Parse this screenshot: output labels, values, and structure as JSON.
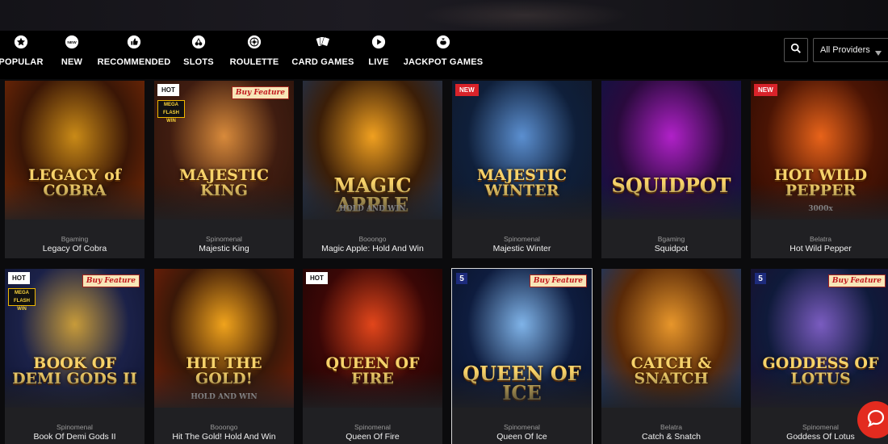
{
  "nav": {
    "items": [
      {
        "label": "POPULAR",
        "icon": "star-icon"
      },
      {
        "label": "NEW",
        "icon": "new-icon",
        "icon_text": "NEW"
      },
      {
        "label": "RECOMMENDED",
        "icon": "thumbs-up-icon"
      },
      {
        "label": "SLOTS",
        "icon": "cherries-icon"
      },
      {
        "label": "ROULETTE",
        "icon": "roulette-icon"
      },
      {
        "label": "CARD GAMES",
        "icon": "cards-icon"
      },
      {
        "label": "LIVE",
        "icon": "play-icon"
      },
      {
        "label": "JACKPOT GAMES",
        "icon": "money-bag-icon"
      }
    ],
    "provider_select": "All Providers"
  },
  "games": [
    {
      "provider": "Bgaming",
      "name": "Legacy Of Cobra",
      "art_title": "LEGACY of COBRA",
      "badge": "",
      "buy_feature": "",
      "colors": [
        "#3a1606",
        "#c98a17",
        "#7a2a05"
      ]
    },
    {
      "provider": "Spinomenal",
      "name": "Majestic King",
      "art_title": "MAJESTIC KING",
      "badge": "HOT",
      "buy_feature": "Buy Feature",
      "mega": "MEGA FLASH WIN",
      "colors": [
        "#3f1c10",
        "#d88a3b",
        "#2a130b"
      ]
    },
    {
      "provider": "Booongo",
      "name": "Magic Apple: Hold And Win",
      "art_title": "MAGIC APPLE",
      "art_subtitle": "HOLD AND WIN",
      "badge": "",
      "buy_feature": "",
      "colors": [
        "#3b1e08",
        "#f0a020",
        "#1c3558"
      ]
    },
    {
      "provider": "Spinomenal",
      "name": "Majestic Winter",
      "art_title": "MAJESTIC WINTER",
      "badge": "NEW",
      "buy_feature": "",
      "colors": [
        "#0f1f3a",
        "#5b8fd0",
        "#101829"
      ]
    },
    {
      "provider": "Bgaming",
      "name": "Squidpot",
      "art_title": "SQUIDPOT",
      "badge": "",
      "buy_feature": "",
      "colors": [
        "#2a0a3d",
        "#b021c8",
        "#0c1444"
      ]
    },
    {
      "provider": "Belatra",
      "name": "Hot Wild Pepper",
      "art_title": "HOT WILD PEPPER",
      "art_subtitle": "3000x",
      "badge": "NEW",
      "buy_feature": "",
      "colors": [
        "#4a1404",
        "#e8631a",
        "#2a0a02"
      ]
    },
    {
      "provider": "Spinomenal",
      "name": "Book Of Demi Gods II",
      "art_title": "BOOK OF DEMI GODS II",
      "badge": "HOT",
      "buy_feature": "Buy Feature",
      "mega": "MEGA FLASH WIN",
      "colors": [
        "#1b2148",
        "#c79b3a",
        "#0f1430"
      ]
    },
    {
      "provider": "Booongo",
      "name": "Hit The Gold! Hold And Win",
      "art_title": "HIT THE GOLD!",
      "art_subtitle": "HOLD AND WIN",
      "badge": "",
      "buy_feature": "",
      "colors": [
        "#3a1808",
        "#f0a31c",
        "#7a2008"
      ]
    },
    {
      "provider": "Spinomenal",
      "name": "Queen Of Fire",
      "art_title": "QUEEN OF FIRE",
      "badge": "HOT",
      "buy_feature": "",
      "colors": [
        "#3a0706",
        "#e2461b",
        "#1a0504"
      ]
    },
    {
      "provider": "Spinomenal",
      "name": "Queen Of Ice",
      "art_title": "QUEEN OF ICE",
      "badge": "",
      "buy_feature": "Buy Feature",
      "five": "5",
      "colors": [
        "#0e1c3e",
        "#7fb3e8",
        "#0a1228"
      ]
    },
    {
      "provider": "Belatra",
      "name": "Catch & Snatch",
      "art_title": "CATCH & SNATCH",
      "badge": "",
      "buy_feature": "",
      "colors": [
        "#5a2a08",
        "#e7962b",
        "#0e3a78"
      ]
    },
    {
      "provider": "Spinomenal",
      "name": "Goddess Of Lotus",
      "art_title": "GODDESS OF LOTUS",
      "badge": "",
      "buy_feature": "Buy Feature",
      "five": "5",
      "colors": [
        "#0f1a3a",
        "#7a5cc0",
        "#1a0f2e"
      ]
    }
  ]
}
